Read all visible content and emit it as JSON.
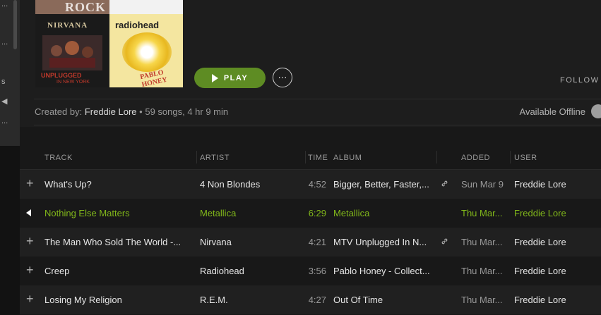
{
  "sidebar": {
    "glyphs": [
      "...",
      "s",
      "...",
      "s",
      "..."
    ]
  },
  "header": {
    "cover_tiles": {
      "rock_text": "ROCK",
      "nirvana_logo": "NIRVANA",
      "nirvana_text": "UNPLUGGED",
      "nirvana_subtext": "IN NEW YORK",
      "radiohead_logo": "radiohead",
      "radiohead_text": "PABLO HONEY"
    },
    "play_label": "PLAY",
    "more_label": "···",
    "follow_label": "FOLLOW",
    "created_by_prefix": "Created by:",
    "owner": "Freddie Lore",
    "summary": "• 59 songs, 4 hr 9 min",
    "offline_label": "Available Offline"
  },
  "columns": {
    "track": "TRACK",
    "artist": "ARTIST",
    "time": "TIME",
    "album": "ALBUM",
    "added": "ADDED",
    "user": "USER"
  },
  "rows": [
    {
      "track": "What's Up?",
      "artist": "4 Non Blondes",
      "time": "4:52",
      "album": "Bigger, Better, Faster,...",
      "added": "Sun Mar 9",
      "user": "Freddie Lore",
      "link": true,
      "playing": false
    },
    {
      "track": "Nothing Else Matters",
      "artist": "Metallica",
      "time": "6:29",
      "album": "Metallica",
      "added": "Thu Mar...",
      "user": "Freddie Lore",
      "link": false,
      "playing": true
    },
    {
      "track": "The Man Who Sold The World -...",
      "artist": "Nirvana",
      "time": "4:21",
      "album": "MTV Unplugged In N...",
      "added": "Thu Mar...",
      "user": "Freddie Lore",
      "link": true,
      "playing": false
    },
    {
      "track": "Creep",
      "artist": "Radiohead",
      "time": "3:56",
      "album": "Pablo Honey - Collect...",
      "added": "Thu Mar...",
      "user": "Freddie Lore",
      "link": false,
      "playing": false
    },
    {
      "track": "Losing My Religion",
      "artist": "R.E.M.",
      "time": "4:27",
      "album": "Out Of Time",
      "added": "Thu Mar...",
      "user": "Freddie Lore",
      "link": false,
      "playing": false
    }
  ],
  "colors": {
    "accent": "#81b71a",
    "play_button": "#5e8c23",
    "background": "#181818"
  }
}
